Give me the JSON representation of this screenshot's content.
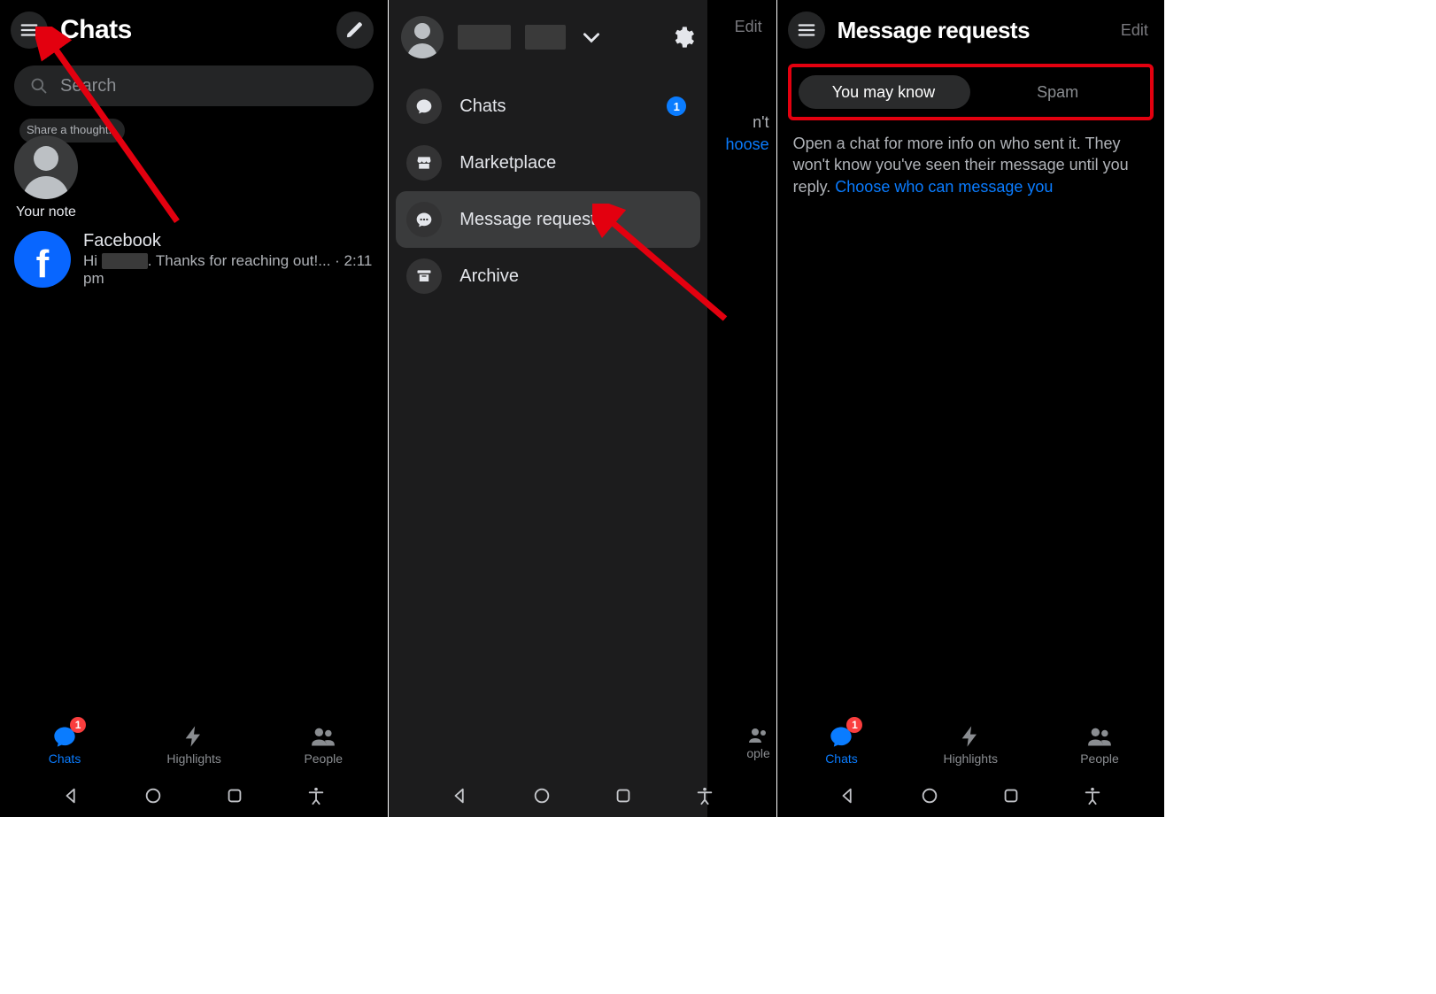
{
  "panel1": {
    "title": "Chats",
    "search_placeholder": "Search",
    "note_bubble": "Share a thought...",
    "note_label": "Your note",
    "chat_name": "Facebook",
    "chat_prefix": "Hi ",
    "chat_suffix": ". Thanks for reaching out!... · 2:11 pm",
    "tabs": {
      "chats": "Chats",
      "highlights": "Highlights",
      "people": "People",
      "badge": "1"
    }
  },
  "panel2": {
    "edit": "Edit",
    "behind_line1": "n't",
    "behind_link": "hoose",
    "peek_label": "ople",
    "menu": {
      "chats": "Chats",
      "chats_badge": "1",
      "marketplace": "Marketplace",
      "message_requests": "Message requests",
      "archive": "Archive"
    }
  },
  "panel3": {
    "title": "Message requests",
    "edit": "Edit",
    "seg_know": "You may know",
    "seg_spam": "Spam",
    "info_text": "Open a chat for more info on who sent it. They won't know you've seen their message until you reply. ",
    "info_link": "Choose who can message you",
    "tabs": {
      "chats": "Chats",
      "highlights": "Highlights",
      "people": "People",
      "badge": "1"
    }
  }
}
